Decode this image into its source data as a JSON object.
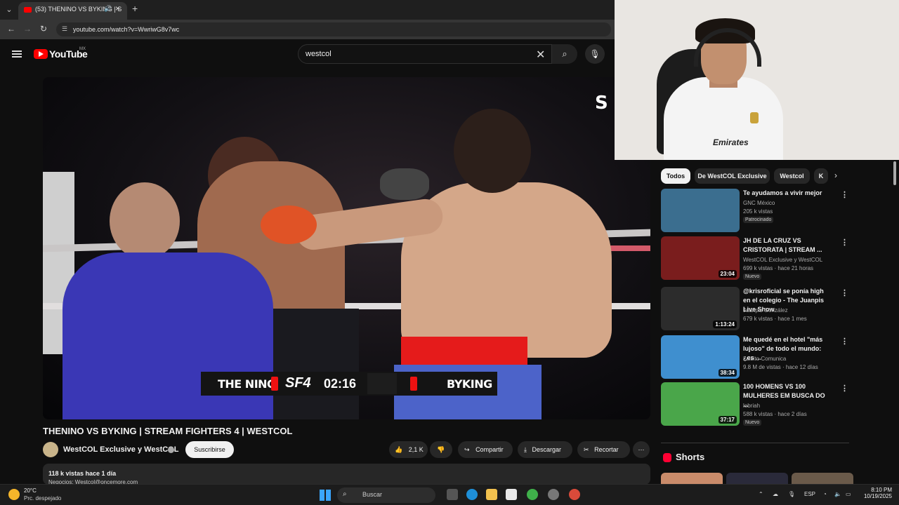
{
  "browser": {
    "tab_title": "(53) THENINO VS BYKING | S",
    "url": "youtube.com/watch?v=WwriwG8v7wc"
  },
  "youtube": {
    "logo_text": "YouTube",
    "country": "MX",
    "search_value": "westcol"
  },
  "video": {
    "overlay_logo": "S",
    "scoreboard": {
      "left_name": "THE NINO",
      "logo": "SF4",
      "time": "02:16",
      "right_name": "BYKING"
    },
    "title": "THENINO VS BYKING | STREAM FIGHTERS 4 | WESTCOL",
    "channel": "WestCOL Exclusive y WestCOL",
    "subscribe_label": "Suscribirse",
    "likes": "2,1 K",
    "share_label": "Compartir",
    "download_label": "Descargar",
    "clip_label": "Recortar",
    "views_meta": "118 k vistas  hace 1 día",
    "desc_cut": "Negocios: Westcol@oncemore.com"
  },
  "webcam": {
    "sponsor": "Emirates"
  },
  "chips": [
    "Todos",
    "De WestCOL Exclusive",
    "Westcol",
    "K"
  ],
  "recommendations": [
    {
      "title": "Te ayudamos a vivir mejor",
      "channel": "GNC México",
      "views": "205 k vistas",
      "badge": "Patrocinado",
      "duration": "",
      "thumb": "#3b6e8f"
    },
    {
      "title": "JH DE LA CRUZ VS CRISTORATA | STREAM ...",
      "channel": "WestCOL Exclusive y WestCOL",
      "views": "699 k vistas · hace 21 horas",
      "badge": "Nuevo",
      "duration": "23:04",
      "thumb": "#7a1d1d"
    },
    {
      "title": "@krisroficial se ponía high en el colegio - The Juanpis Live Show",
      "channel": "Juanpis González",
      "views": "679 k vistas · hace 1 mes",
      "badge": "",
      "duration": "1:13:24",
      "thumb": "#2c2c2c"
    },
    {
      "title": "Me quedé en el hotel \"más lujoso\" de todo el mundo: ¿es ...",
      "channel": "Luisito Comunica",
      "views": "9.8 M de vistas · hace 12 días",
      "badge": "",
      "duration": "38:34",
      "thumb": "#3f8fcf"
    },
    {
      "title": "100 HOMENS VS 100 MULHERES EM BUSCA DO ...",
      "channel": "lebriah",
      "views": "588 k vistas · hace 2 días",
      "badge": "Nuevo",
      "duration": "37:17",
      "thumb": "#4aa64a"
    }
  ],
  "shorts_label": "Shorts",
  "taskbar": {
    "temp": "20°C",
    "weather": "Prc. despejado",
    "search": "Buscar",
    "lang": "ESP",
    "time": "8:10 PM",
    "date": "10/19/2025"
  }
}
